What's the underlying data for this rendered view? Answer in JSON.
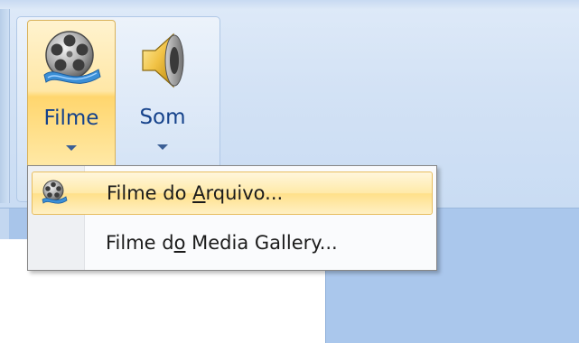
{
  "ribbon": {
    "buttons": [
      {
        "label": "Filme",
        "icon": "film-reel-icon",
        "state": "pressed"
      },
      {
        "label": "Som",
        "icon": "speaker-icon",
        "state": "normal"
      }
    ]
  },
  "menu": {
    "items": [
      {
        "prefix": "Filme do ",
        "mnemonic": "A",
        "suffix": "rquivo...",
        "icon": "film-reel-icon",
        "highlighted": true
      },
      {
        "prefix": "Filme d",
        "mnemonic": "o",
        "suffix": " Media Gallery...",
        "icon": "",
        "highlighted": false
      }
    ]
  },
  "colors": {
    "accent_highlight": "#ffe08a",
    "ribbon_text": "#15428b",
    "ribbon_bg": "#d3e2f5"
  }
}
